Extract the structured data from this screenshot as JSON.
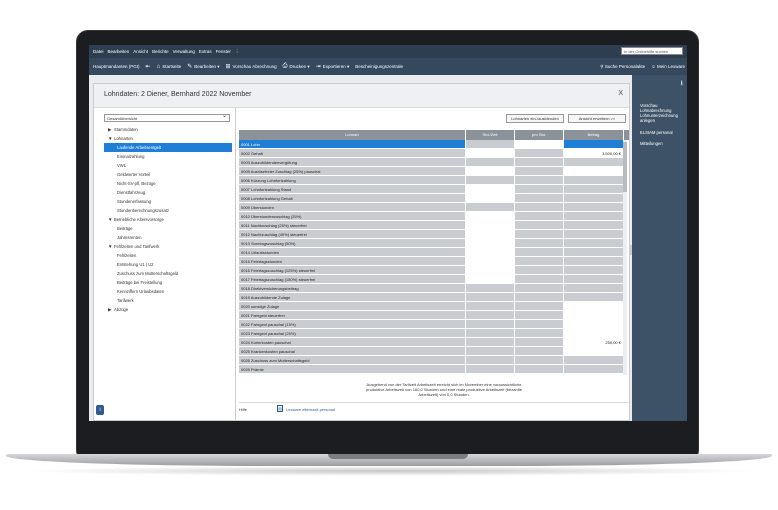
{
  "menu": [
    "Datei",
    "Bearbeiten",
    "Ansicht",
    "Berichte",
    "Verwaltung",
    "Extras",
    "Fenster",
    "⋮"
  ],
  "search_placeholder": "In der Onlinehilfe suchen",
  "toolbar": {
    "company": "Hauptmandanten (PGI)",
    "items": [
      {
        "icon": "home-icon",
        "glyph": "⌂",
        "label": "Startseite"
      },
      {
        "icon": "edit-icon",
        "glyph": "✎",
        "label": "Bearbeiten ▾"
      },
      {
        "icon": "calculator-icon",
        "glyph": "⊞",
        "label": "Vorschau Abrechnung"
      },
      {
        "icon": "print-icon",
        "glyph": "⎙",
        "label": "Drucken ▾"
      },
      {
        "icon": "export-icon",
        "glyph": "⇥",
        "label": "Exportieren ▾"
      },
      {
        "icon": "none",
        "glyph": "",
        "label": "Bescheinigungszentrale"
      }
    ],
    "right_items": [
      "Suche Personalakte",
      "Mein Lexware"
    ]
  },
  "right_panel": {
    "items": [
      "Vorschau Lohnabrechnung",
      "Lohnunterzeichnung anlegen",
      "ELStAM personal",
      "Mitteilungen"
    ]
  },
  "dialog": {
    "title": "Lohndaten: 2  Diener, Bernhard   2022   November",
    "close": "X",
    "dropdown": "Gesamtübersicht",
    "tree": [
      {
        "label": "Stammdaten",
        "level": 0,
        "arrow": "▶"
      },
      {
        "label": "Lohnarten",
        "level": 0,
        "arrow": "▼"
      },
      {
        "label": "Laufende Arbeitsentgelt",
        "level": 1,
        "selected": true
      },
      {
        "label": "Einmalzahlung",
        "level": 1
      },
      {
        "label": "VWL",
        "level": 1
      },
      {
        "label": "Geldwerter Vorteil",
        "level": 1
      },
      {
        "label": "Nicht-SV-pfl. Bezüge",
        "level": 1
      },
      {
        "label": "Dienstfahrzeug",
        "level": 1
      },
      {
        "label": "Stundenerfassung",
        "level": 1
      },
      {
        "label": "Stundenberechnungszusatz",
        "level": 1
      },
      {
        "label": "Betriebliche Altersvorsorge",
        "level": 0,
        "arrow": "▼"
      },
      {
        "label": "Beiträge",
        "level": 1
      },
      {
        "label": "Jahresrenten",
        "level": 1
      },
      {
        "label": "Fehlzeiten und Tarifwerk",
        "level": 0,
        "arrow": "▼"
      },
      {
        "label": "Fehlzeiten",
        "level": 1
      },
      {
        "label": "Entstehung U1 | U2",
        "level": 1
      },
      {
        "label": "Zuschuss zum Mutterschaftsgeld",
        "level": 1
      },
      {
        "label": "Beiträge bei Freistellung",
        "level": 1
      },
      {
        "label": "Kennziffern Urlaubsdaten",
        "level": 1
      },
      {
        "label": "Tarifwerk",
        "level": 1
      },
      {
        "label": "Abzüge",
        "level": 0,
        "arrow": "▶"
      }
    ],
    "buttons": {
      "hide_lohnarten": "Lohnarten ein-/ausblenden",
      "ansicht": "Ansicht erweitern >>"
    },
    "columns": [
      "Lohnart",
      "Std./Zeit",
      "pro Std.",
      "Betrag"
    ],
    "rows": [
      {
        "name": "0001 Lohn",
        "c1": "",
        "c2": "",
        "c3": "",
        "sel": true,
        "p": "gww"
      },
      {
        "name": "0002 Gehalt",
        "c1": "",
        "c2": "",
        "c3": "3.500,00 €",
        "p": "wgw"
      },
      {
        "name": "0003 Auszubildendenvergütung",
        "c1": "",
        "c2": "",
        "c3": "",
        "p": "ggg"
      },
      {
        "name": "0005 Auslösefreier Zuschlag (25%) pauschal",
        "c1": "",
        "c2": "",
        "c3": "",
        "p": "wgw"
      },
      {
        "name": "0006 Kürzung Lohnfortzahlung",
        "c1": "",
        "c2": "",
        "c3": "",
        "p": "ggg"
      },
      {
        "name": "0007 Lohnfortzahlung Stand",
        "c1": "",
        "c2": "",
        "c3": "",
        "p": "wgg"
      },
      {
        "name": "0008 Lohnfortzahlung Gehalt",
        "c1": "",
        "c2": "",
        "c3": "",
        "p": "wgg"
      },
      {
        "name": "0009 Überstunden",
        "c1": "",
        "c2": "",
        "c3": "",
        "p": "ggg"
      },
      {
        "name": "0010 Überstundenzuschlag (25%)",
        "c1": "",
        "c2": "",
        "c3": "",
        "p": "wgg"
      },
      {
        "name": "0011 Nachtzuschlag (25%) steuerfrei",
        "c1": "",
        "c2": "",
        "c3": "",
        "p": "wgg"
      },
      {
        "name": "0012 Nachtzuschlag (40%) steuerfrei",
        "c1": "",
        "c2": "",
        "c3": "",
        "p": "wgg"
      },
      {
        "name": "0013 Sonntagszuschlag (50%)",
        "c1": "",
        "c2": "",
        "c3": "",
        "p": "wgg"
      },
      {
        "name": "0014 Urlaubsstunden",
        "c1": "",
        "c2": "",
        "c3": "",
        "p": "wgg"
      },
      {
        "name": "0015 Feiertagsstunden",
        "c1": "",
        "c2": "",
        "c3": "",
        "p": "wgg"
      },
      {
        "name": "0016 Feiertagszuschlag (125%) steuerfrei",
        "c1": "",
        "c2": "",
        "c3": "",
        "p": "wgg"
      },
      {
        "name": "0017 Feiertagszuschlag (150%) steuerfrei",
        "c1": "",
        "c2": "",
        "c3": "",
        "p": "wgg"
      },
      {
        "name": "0018 Direktversicherungsbeitrag",
        "c1": "",
        "c2": "",
        "c3": "",
        "p": "ggg"
      },
      {
        "name": "0019 Auszubildende Zulage",
        "c1": "",
        "c2": "",
        "c3": "",
        "p": "ggg"
      },
      {
        "name": "0020 sonstige Zulage",
        "c1": "",
        "c2": "",
        "c3": "",
        "p": "ggw"
      },
      {
        "name": "0021 Fahrgeld steuerfrei",
        "c1": "",
        "c2": "",
        "c3": "",
        "p": "ggw"
      },
      {
        "name": "0022 Fahrgeld pauschal (15%)",
        "c1": "",
        "c2": "",
        "c3": "",
        "p": "ggw"
      },
      {
        "name": "0023 Fahrgeld pauschal (25%)",
        "c1": "",
        "c2": "",
        "c3": "",
        "p": "ggw"
      },
      {
        "name": "0024 Kurierkosten pauschal",
        "c1": "",
        "c2": "",
        "c3": "250,00 €",
        "p": "ggw"
      },
      {
        "name": "0025 Krankenkosten pauschal",
        "c1": "",
        "c2": "",
        "c3": "",
        "p": "ggw"
      },
      {
        "name": "0026 Zuschuss zum Mutterschaftsgeld",
        "c1": "",
        "c2": "",
        "c3": "",
        "p": "ggg"
      },
      {
        "name": "0029 Prämie",
        "c1": "",
        "c2": "",
        "c3": "",
        "p": "ggg"
      }
    ],
    "note": "Ausgehend von der Tarifzeit Arbeitszeit erreicht sich im November eine voraussichtliche produktive Arbeitszeit von 160,0 Stunden und eine reale produktive Arbeitszeit (bezahlte Arbeitszeit) von 0,0 Stunden.",
    "foot_hint": "Hilfe",
    "foot_link": "Lexware elternzeit personal"
  }
}
